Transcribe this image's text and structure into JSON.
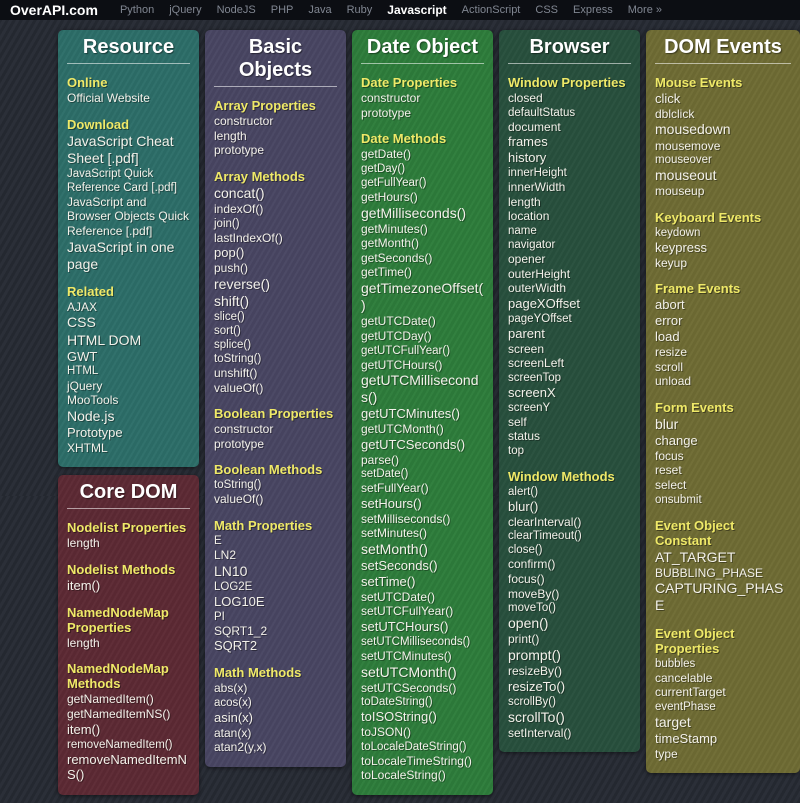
{
  "nav": {
    "logo": "OverAPI.com",
    "links": [
      "Python",
      "jQuery",
      "NodeJS",
      "PHP",
      "Java",
      "Ruby",
      "Javascript",
      "ActionScript",
      "CSS",
      "Express",
      "More »"
    ],
    "active": "Javascript"
  },
  "colors": {
    "background": "#262a33",
    "navbar": "#0c0e13",
    "heading_yellow": "#efe968",
    "resource_card": "#2d6e69",
    "core_dom_card": "#5d2a34",
    "basic_objects_card": "#494663",
    "date_object_card": "#2e7d3b",
    "browser_card": "#28503d",
    "dom_events_card": "#6f6c34"
  },
  "columns": [
    {
      "cards": [
        {
          "title": "Resource",
          "color": "#2d6e69",
          "sections": [
            {
              "heading": "Online",
              "items": [
                "Official Website"
              ]
            },
            {
              "heading": "Download",
              "items": [
                "JavaScript Cheat Sheet [.pdf]",
                "JavaScript Quick Reference Card [.pdf]",
                "JavaScript and Browser Objects Quick Reference [.pdf]",
                "JavaScript in one page"
              ]
            },
            {
              "heading": "Related",
              "items": [
                "AJAX",
                "CSS",
                "HTML DOM",
                "GWT",
                "HTML",
                "jQuery",
                "MooTools",
                "Node.js",
                "Prototype",
                "XHTML"
              ]
            }
          ]
        },
        {
          "title": "Core DOM",
          "color": "#5d2a34",
          "sections": [
            {
              "heading": "Nodelist Properties",
              "items": [
                "length"
              ]
            },
            {
              "heading": "Nodelist Methods",
              "items": [
                "item()"
              ]
            },
            {
              "heading": "NamedNodeMap Properties",
              "items": [
                "length"
              ]
            },
            {
              "heading": "NamedNodeMap Methods",
              "items": [
                "getNamedItem()",
                "getNamedItemNS()",
                "item()",
                "removeNamedItem()",
                "removeNamedItemNS()"
              ]
            }
          ]
        }
      ]
    },
    {
      "cards": [
        {
          "title": "Basic Objects",
          "color": "#494663",
          "sections": [
            {
              "heading": "Array Properties",
              "items": [
                "constructor",
                "length",
                "prototype"
              ]
            },
            {
              "heading": "Array Methods",
              "items": [
                "concat()",
                "indexOf()",
                "join()",
                "lastIndexOf()",
                "pop()",
                "push()",
                "reverse()",
                "shift()",
                "slice()",
                "sort()",
                "splice()",
                "toString()",
                "unshift()",
                "valueOf()"
              ]
            },
            {
              "heading": "Boolean Properties",
              "items": [
                "constructor",
                "prototype"
              ]
            },
            {
              "heading": "Boolean Methods",
              "items": [
                "toString()",
                "valueOf()"
              ]
            },
            {
              "heading": "Math Properties",
              "items": [
                "E",
                "LN2",
                "LN10",
                "LOG2E",
                "LOG10E",
                "PI",
                "SQRT1_2",
                "SQRT2"
              ]
            },
            {
              "heading": "Math Methods",
              "items": [
                "abs(x)",
                "acos(x)",
                "asin(x)",
                "atan(x)",
                "atan2(y,x)"
              ]
            }
          ]
        }
      ]
    },
    {
      "cards": [
        {
          "title": "Date Object",
          "color": "#2e7d3b",
          "sections": [
            {
              "heading": "Date Properties",
              "items": [
                "constructor",
                "prototype"
              ]
            },
            {
              "heading": "Date Methods",
              "items": [
                "getDate()",
                "getDay()",
                "getFullYear()",
                "getHours()",
                "getMilliseconds()",
                "getMinutes()",
                "getMonth()",
                "getSeconds()",
                "getTime()",
                "getTimezoneOffset()",
                "getUTCDate()",
                "getUTCDay()",
                "getUTCFullYear()",
                "getUTCHours()",
                "getUTCMilliseconds()",
                "getUTCMinutes()",
                "getUTCMonth()",
                "getUTCSeconds()",
                "parse()",
                "setDate()",
                "setFullYear()",
                "setHours()",
                "setMilliseconds()",
                "setMinutes()",
                "setMonth()",
                "setSeconds()",
                "setTime()",
                "setUTCDate()",
                "setUTCFullYear()",
                "setUTCHours()",
                "setUTCMilliseconds()",
                "setUTCMinutes()",
                "setUTCMonth()",
                "setUTCSeconds()",
                "toDateString()",
                "toISOString()",
                "toJSON()",
                "toLocaleDateString()",
                "toLocaleTimeString()",
                "toLocaleString()"
              ]
            }
          ]
        }
      ]
    },
    {
      "cards": [
        {
          "title": "Browser",
          "color": "#28503d",
          "sections": [
            {
              "heading": "Window Properties",
              "items": [
                "closed",
                "defaultStatus",
                "document",
                "frames",
                "history",
                "innerHeight",
                "innerWidth",
                "length",
                "location",
                "name",
                "navigator",
                "opener",
                "outerHeight",
                "outerWidth",
                "pageXOffset",
                "pageYOffset",
                "parent",
                "screen",
                "screenLeft",
                "screenTop",
                "screenX",
                "screenY",
                "self",
                "status",
                "top"
              ]
            },
            {
              "heading": "Window Methods",
              "items": [
                "alert()",
                "blur()",
                "clearInterval()",
                "clearTimeout()",
                "close()",
                "confirm()",
                "focus()",
                "moveBy()",
                "moveTo()",
                "open()",
                "print()",
                "prompt()",
                "resizeBy()",
                "resizeTo()",
                "scrollBy()",
                "scrollTo()",
                "setInterval()"
              ]
            }
          ]
        }
      ]
    },
    {
      "cards": [
        {
          "title": "DOM Events",
          "color": "#6f6c34",
          "sections": [
            {
              "heading": "Mouse Events",
              "items": [
                "click",
                "dblclick",
                "mousedown",
                "mousemove",
                "mouseover",
                "mouseout",
                "mouseup"
              ]
            },
            {
              "heading": "Keyboard Events",
              "items": [
                "keydown",
                "keypress",
                "keyup"
              ]
            },
            {
              "heading": "Frame Events",
              "items": [
                "abort",
                "error",
                "load",
                "resize",
                "scroll",
                "unload"
              ]
            },
            {
              "heading": "Form Events",
              "items": [
                "blur",
                "change",
                "focus",
                "reset",
                "select",
                "onsubmit"
              ]
            },
            {
              "heading": "Event Object Constant",
              "items": [
                "AT_TARGET",
                "BUBBLING_PHASE",
                "CAPTURING_PHASE"
              ]
            },
            {
              "heading": "Event Object Properties",
              "items": [
                "bubbles",
                "cancelable",
                "currentTarget",
                "eventPhase",
                "target",
                "timeStamp",
                "type"
              ]
            }
          ]
        }
      ]
    }
  ]
}
